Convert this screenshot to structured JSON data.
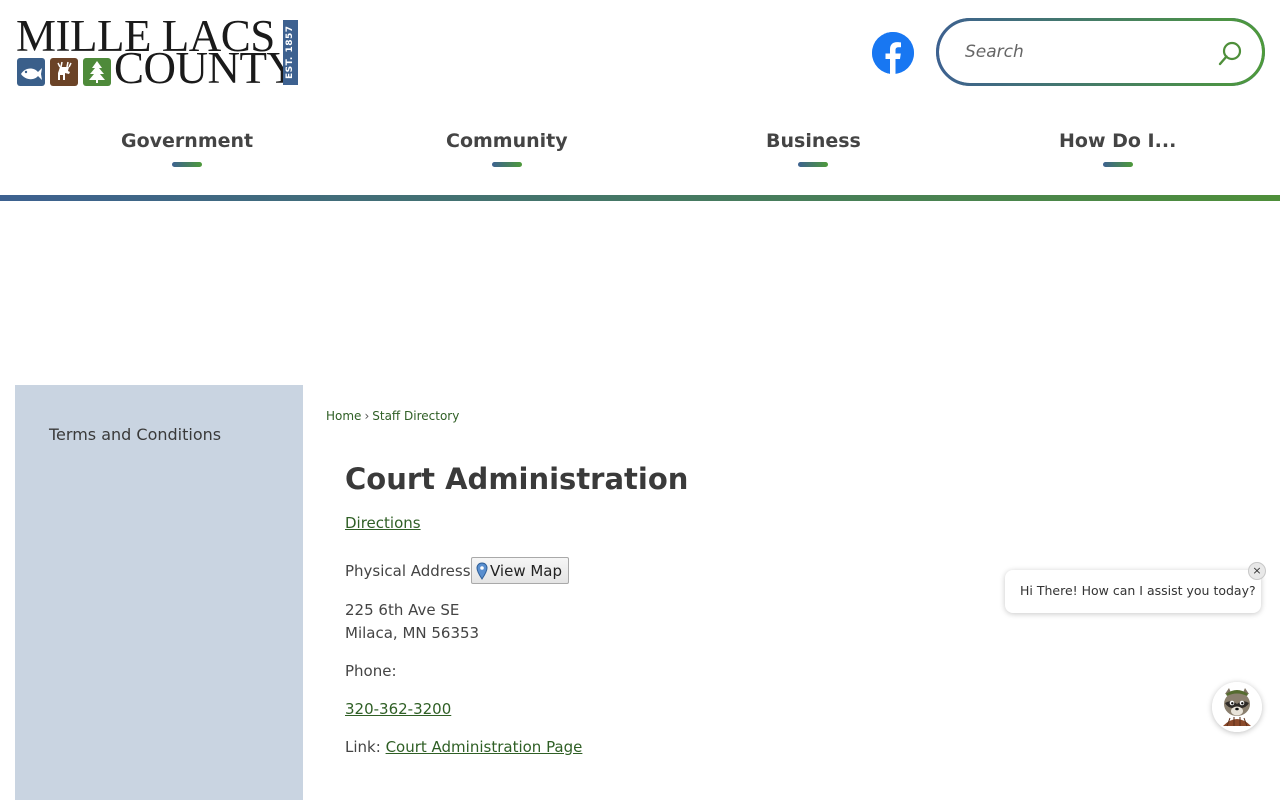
{
  "header": {
    "logo": {
      "line1": "MILLE LACS",
      "line2": "COUNTY",
      "est": "EST. 1857"
    },
    "social": {
      "icon": "facebook-icon"
    },
    "search": {
      "placeholder": "Search",
      "icon": "search-icon"
    }
  },
  "nav": {
    "items": [
      {
        "label": "Government"
      },
      {
        "label": "Community"
      },
      {
        "label": "Business"
      },
      {
        "label": "How Do I..."
      }
    ]
  },
  "sidebar": {
    "items": [
      {
        "label": "Terms and Conditions"
      }
    ]
  },
  "breadcrumb": {
    "home": "Home",
    "separator": "›",
    "current": "Staff Directory"
  },
  "main": {
    "title": "Court Administration",
    "directions": "Directions",
    "physical_address_label": "Physical Address:",
    "view_map": "View Map",
    "address_line1": "225 6th Ave SE",
    "address_line2": "Milaca, MN 56353",
    "phone_label": "Phone:",
    "phone": "320-362-3200",
    "link_label": "Link:",
    "link_text": "Court Administration Page"
  },
  "chat": {
    "message": "Hi There! How can I assist you today?",
    "close": "×"
  },
  "colors": {
    "blue": "#3d6190",
    "green": "#4e9a3a",
    "link": "#2f5f25",
    "sidebar_bg": "#c9d4e1",
    "facebook": "#1877f2"
  }
}
